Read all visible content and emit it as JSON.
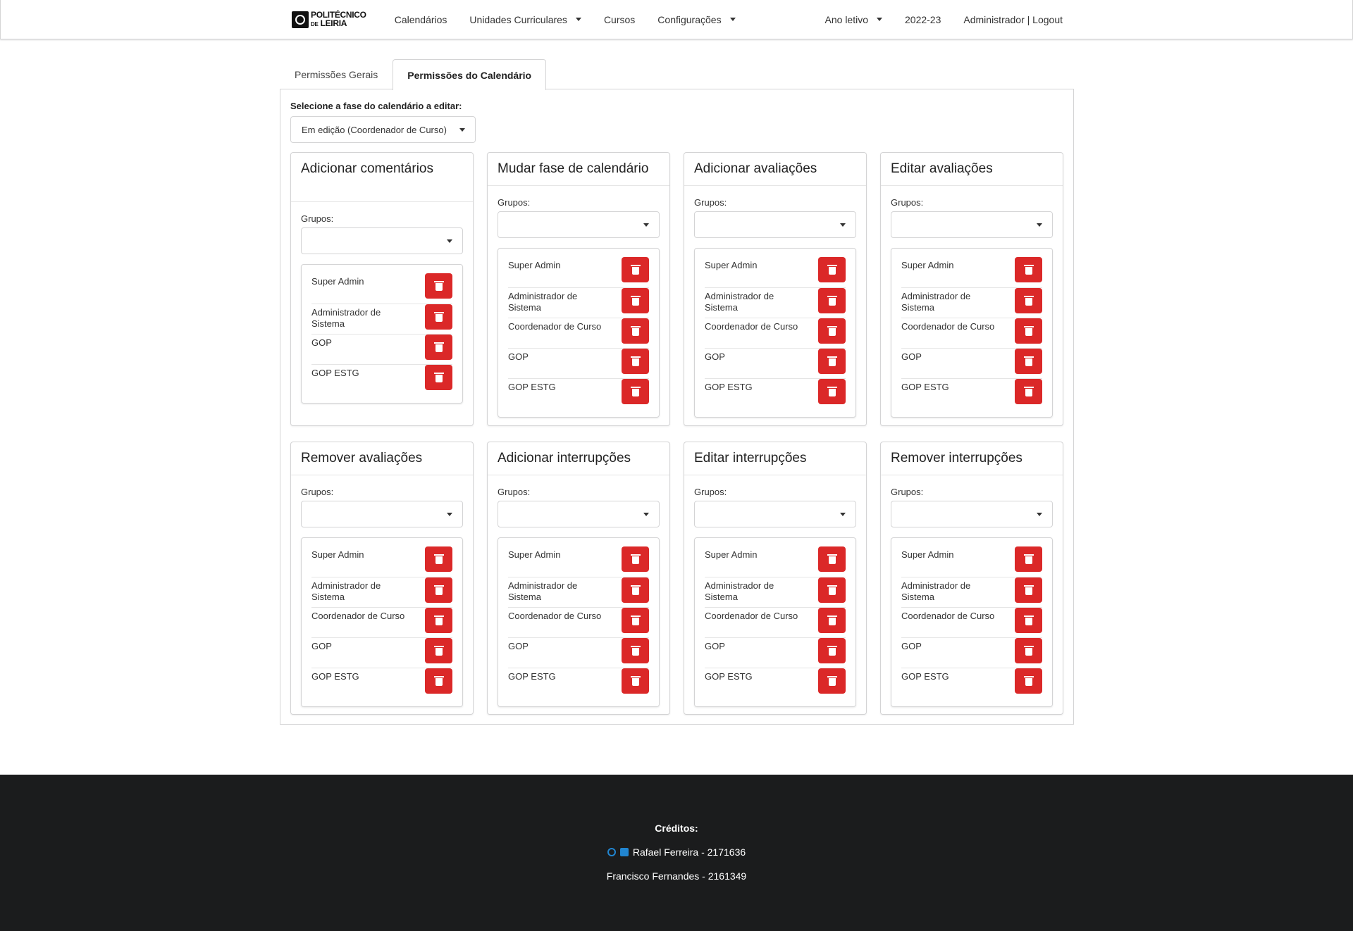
{
  "nav": {
    "logo_top": "POLITÉCNICO",
    "logo_de": "DE",
    "logo_bottom": "LEIRIA",
    "items": [
      "Calendários",
      "Unidades Curriculares",
      "Cursos",
      "Configurações"
    ],
    "ano_letivo": "Ano letivo",
    "year": "2022-23",
    "user": "Administrador | Logout"
  },
  "tabs": [
    "Permissões Gerais",
    "Permissões do Calendário"
  ],
  "phase": {
    "label": "Selecione a fase do calendário a editar:",
    "value": "Em edição (Coordenador de Curso)"
  },
  "groups_label": "Grupos:",
  "cards": [
    {
      "title": "Adicionar comentários",
      "groups": [
        "Super Admin",
        "Administrador de Sistema",
        "GOP",
        "GOP ESTG"
      ]
    },
    {
      "title": "Mudar fase de calendário",
      "groups": [
        "Super Admin",
        "Administrador de Sistema",
        "Coordenador de Curso",
        "GOP",
        "GOP ESTG"
      ]
    },
    {
      "title": "Adicionar avaliações",
      "groups": [
        "Super Admin",
        "Administrador de Sistema",
        "Coordenador de Curso",
        "GOP",
        "GOP ESTG"
      ]
    },
    {
      "title": "Editar avaliações",
      "groups": [
        "Super Admin",
        "Administrador de Sistema",
        "Coordenador de Curso",
        "GOP",
        "GOP ESTG"
      ]
    },
    {
      "title": "Remover avaliações",
      "groups": [
        "Super Admin",
        "Administrador de Sistema",
        "Coordenador de Curso",
        "GOP",
        "GOP ESTG"
      ]
    },
    {
      "title": "Adicionar interrupções",
      "groups": [
        "Super Admin",
        "Administrador de Sistema",
        "Coordenador de Curso",
        "GOP",
        "GOP ESTG"
      ]
    },
    {
      "title": "Editar interrupções",
      "groups": [
        "Super Admin",
        "Administrador de Sistema",
        "Coordenador de Curso",
        "GOP",
        "GOP ESTG"
      ]
    },
    {
      "title": "Remover interrupções",
      "groups": [
        "Super Admin",
        "Administrador de Sistema",
        "Coordenador de Curso",
        "GOP",
        "GOP ESTG"
      ]
    }
  ],
  "footer": {
    "title": "Créditos:",
    "credit1": "Rafael Ferreira - 2171636",
    "credit2": "Francisco Fernandes - 2161349"
  },
  "colors": {
    "danger": "#db2828",
    "footer_bg": "#1b1c1d",
    "link": "#2185d0"
  },
  "icons": {
    "delete": "trash-icon",
    "github": "github-icon",
    "linkedin": "linkedin-icon"
  }
}
